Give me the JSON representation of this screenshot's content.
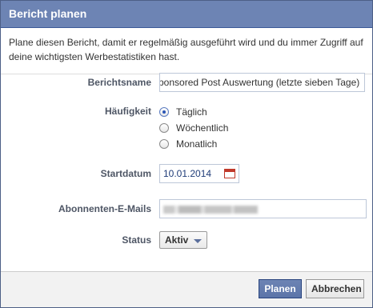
{
  "dialog": {
    "title": "Bericht planen",
    "intro": "Plane diesen Bericht, damit er regelmäßig ausgeführt wird und du immer Zugriff auf deine wichtigsten Werbestatistiken hast."
  },
  "form": {
    "name_label": "Berichtsname",
    "name_value": "Sponsored Post Auswertung (letzte sieben Tage)",
    "frequency_label": "Häufigkeit",
    "frequency_options": [
      "Täglich",
      "Wöchentlich",
      "Monatlich"
    ],
    "frequency_selected": "Täglich",
    "start_label": "Startdatum",
    "start_value": "10.01.2014",
    "emails_label": "Abonnenten-E-Mails",
    "emails_value": "",
    "status_label": "Status",
    "status_value": "Aktiv"
  },
  "buttons": {
    "submit": "Planen",
    "cancel": "Abbrechen"
  },
  "colors": {
    "titlebar": "#6d84b4",
    "primary_button": "#5b74a8",
    "label": "#4e5665"
  },
  "icons": {
    "calendar": "calendar-icon",
    "dropdown": "chevron-down-icon"
  }
}
